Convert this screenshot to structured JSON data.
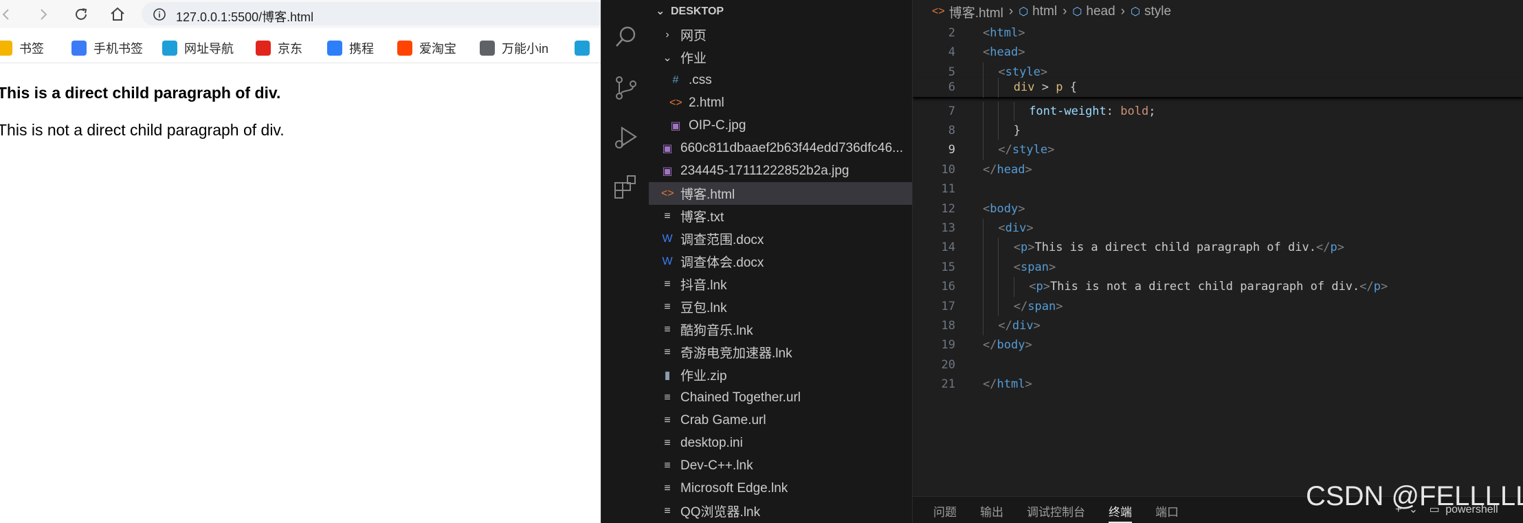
{
  "browser": {
    "url": "127.0.0.1:5500/博客.html",
    "bookmarks": [
      {
        "label": "书签",
        "icon": "star-icon",
        "color": "#f5b400"
      },
      {
        "label": "手机书签",
        "icon": "phone-icon",
        "color": "#3b7cf6"
      },
      {
        "label": "网址导航",
        "icon": "edge-icon",
        "color": "#1f9fd8"
      },
      {
        "label": "京东",
        "icon": "jd-icon",
        "color": "#e1251b"
      },
      {
        "label": "携程",
        "icon": "ctrip-icon",
        "color": "#2d7ff9"
      },
      {
        "label": "爱淘宝",
        "icon": "taobao-icon",
        "color": "#ff4400"
      },
      {
        "label": "万能小in",
        "icon": "wanneng-icon",
        "color": "#5f6368"
      }
    ],
    "page": {
      "bold_paragraph": "This is a direct child paragraph of div.",
      "normal_paragraph": "This is not a direct child paragraph of div."
    }
  },
  "explorer": {
    "header": "DESKTOP",
    "items": [
      {
        "label": "网页",
        "icon": "chevron-right-icon",
        "glyph": "›",
        "indent": 0,
        "color": "#cccccc"
      },
      {
        "label": "作业",
        "icon": "chevron-down-icon",
        "glyph": "⌄",
        "indent": 0,
        "color": "#cccccc"
      },
      {
        "label": ".css",
        "icon": "css-file-icon",
        "glyph": "#",
        "indent": 1,
        "color": "#519aba"
      },
      {
        "label": "2.html",
        "icon": "html-file-icon",
        "glyph": "<>",
        "indent": 1,
        "color": "#e37933"
      },
      {
        "label": "OIP-C.jpg",
        "icon": "image-file-icon",
        "glyph": "▣",
        "indent": 1,
        "color": "#a074c4"
      },
      {
        "label": "660c811dbaaef2b63f44edd736dfc46...",
        "icon": "image-file-icon",
        "glyph": "▣",
        "indent": 0,
        "color": "#a074c4"
      },
      {
        "label": "234445-17111222852b2a.jpg",
        "icon": "image-file-icon",
        "glyph": "▣",
        "indent": 0,
        "color": "#a074c4"
      },
      {
        "label": "博客.html",
        "icon": "html-file-icon",
        "glyph": "<>",
        "indent": 0,
        "color": "#e37933",
        "selected": true
      },
      {
        "label": "博客.txt",
        "icon": "text-file-icon",
        "glyph": "≡",
        "indent": 0,
        "color": "#cccccc"
      },
      {
        "label": "调查范围.docx",
        "icon": "word-file-icon",
        "glyph": "W",
        "indent": 0,
        "color": "#3b7cf6"
      },
      {
        "label": "调查体会.docx",
        "icon": "word-file-icon",
        "glyph": "W",
        "indent": 0,
        "color": "#3b7cf6"
      },
      {
        "label": "抖音.lnk",
        "icon": "text-file-icon",
        "glyph": "≡",
        "indent": 0,
        "color": "#cccccc"
      },
      {
        "label": "豆包.lnk",
        "icon": "text-file-icon",
        "glyph": "≡",
        "indent": 0,
        "color": "#cccccc"
      },
      {
        "label": "酷狗音乐.lnk",
        "icon": "text-file-icon",
        "glyph": "≡",
        "indent": 0,
        "color": "#cccccc"
      },
      {
        "label": "奇游电竞加速器.lnk",
        "icon": "text-file-icon",
        "glyph": "≡",
        "indent": 0,
        "color": "#cccccc"
      },
      {
        "label": "作业.zip",
        "icon": "zip-file-icon",
        "glyph": "▮",
        "indent": 0,
        "color": "#8b9cad"
      },
      {
        "label": "Chained Together.url",
        "icon": "text-file-icon",
        "glyph": "≡",
        "indent": 0,
        "color": "#cccccc"
      },
      {
        "label": "Crab Game.url",
        "icon": "text-file-icon",
        "glyph": "≡",
        "indent": 0,
        "color": "#cccccc"
      },
      {
        "label": "desktop.ini",
        "icon": "text-file-icon",
        "glyph": "≡",
        "indent": 0,
        "color": "#cccccc"
      },
      {
        "label": "Dev-C++.lnk",
        "icon": "text-file-icon",
        "glyph": "≡",
        "indent": 0,
        "color": "#cccccc"
      },
      {
        "label": "Microsoft Edge.lnk",
        "icon": "text-file-icon",
        "glyph": "≡",
        "indent": 0,
        "color": "#cccccc"
      },
      {
        "label": "QQ浏览器.lnk",
        "icon": "text-file-icon",
        "glyph": "≡",
        "indent": 0,
        "color": "#cccccc"
      }
    ]
  },
  "editor": {
    "breadcrumb": [
      "博客.html",
      "html",
      "head",
      "style"
    ],
    "active_line": 9,
    "lines": [
      {
        "n": 2,
        "text": "<html>",
        "indent": 0
      },
      {
        "n": 4,
        "text": "<head>",
        "indent": 0
      },
      {
        "n": 5,
        "text": "<style>",
        "indent": 1
      },
      {
        "n": 6,
        "text": "div > p {",
        "indent": 2,
        "sticky": true
      },
      {
        "n": 7,
        "text": "font-weight: bold;",
        "indent": 3
      },
      {
        "n": 8,
        "text": "}",
        "indent": 2
      },
      {
        "n": 9,
        "text": "</style>",
        "indent": 1
      },
      {
        "n": 10,
        "text": "</head>",
        "indent": 0
      },
      {
        "n": 11,
        "text": "",
        "indent": 0
      },
      {
        "n": 12,
        "text": "<body>",
        "indent": 0
      },
      {
        "n": 13,
        "text": "<div>",
        "indent": 1
      },
      {
        "n": 14,
        "text": "<p>This is a direct child paragraph of div.</p>",
        "indent": 2
      },
      {
        "n": 15,
        "text": "<span>",
        "indent": 2
      },
      {
        "n": 16,
        "text": "<p>This is not a direct child paragraph of div.</p>",
        "indent": 3
      },
      {
        "n": 17,
        "text": "</span>",
        "indent": 2
      },
      {
        "n": 18,
        "text": "</div>",
        "indent": 1
      },
      {
        "n": 19,
        "text": "</body>",
        "indent": 0
      },
      {
        "n": 20,
        "text": "",
        "indent": 0
      },
      {
        "n": 21,
        "text": "</html>",
        "indent": 0
      }
    ]
  },
  "panel": {
    "tabs": [
      "问题",
      "输出",
      "调试控制台",
      "终端",
      "端口"
    ],
    "active_tab": "终端",
    "terminal_label": "powershell"
  },
  "watermark": "CSDN @FELLLLL",
  "colors": {
    "tag": "#569cd6",
    "bracket": "#808080",
    "selector": "#d7ba7d",
    "property": "#9cdcfe",
    "value": "#ce9178"
  }
}
